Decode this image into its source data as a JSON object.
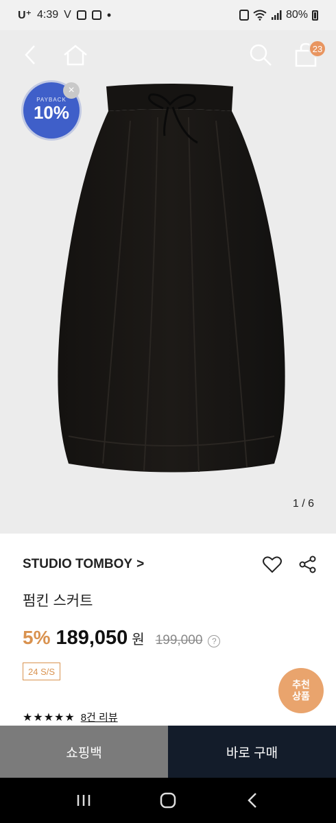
{
  "status_bar": {
    "carrier": "U⁺",
    "time": "4:39",
    "extra": "V",
    "dot": "•",
    "battery_pct": "80%"
  },
  "top_nav": {
    "cart_count": "23"
  },
  "payback": {
    "label": "PAYBACK",
    "percent": "10%",
    "close": "×"
  },
  "gallery": {
    "indicator": "1 / 6"
  },
  "product": {
    "brand": "STUDIO TOMBOY",
    "brand_chevron": ">",
    "name": "펌킨 스커트",
    "discount": "5%",
    "price": "189,050",
    "currency": "원",
    "original_price": "199,000",
    "help": "?",
    "season_tag": "24 S/S",
    "rating_stars": "★★★★★",
    "review_link": "8건 리뷰"
  },
  "recommend": {
    "line1": "추천",
    "line2": "상품"
  },
  "bottom_bar": {
    "shopping_bag": "쇼핑백",
    "buy_now": "바로 구매"
  },
  "colors": {
    "accent": "#d9924f",
    "badge": "#e89560",
    "payback_blue": "#3f5fc9",
    "buy_button": "#131c2a",
    "bag_button": "#7b7b7b"
  }
}
